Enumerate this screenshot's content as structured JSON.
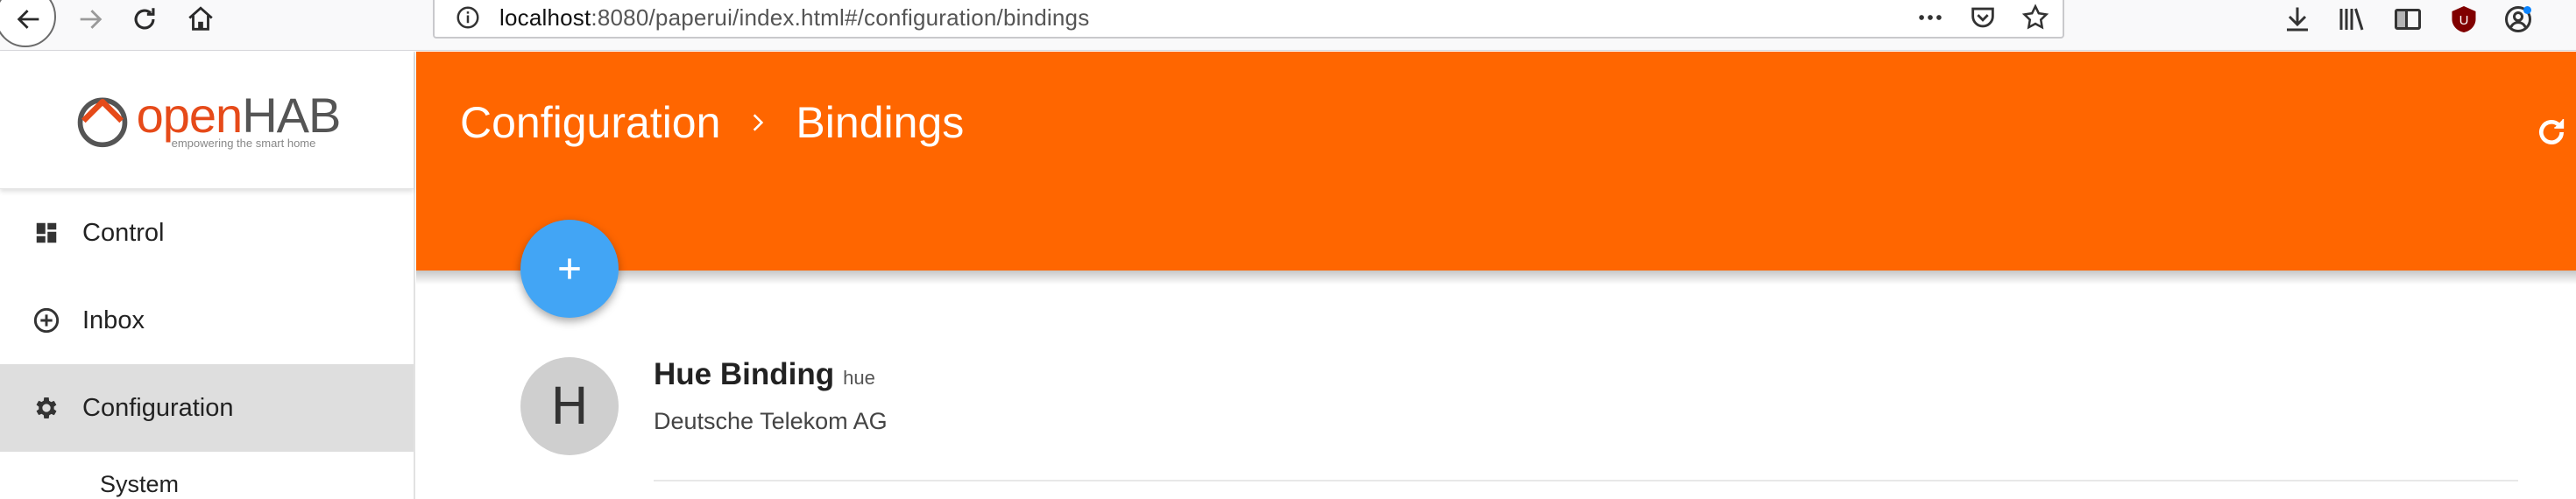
{
  "browser": {
    "url_host": "localhost",
    "url_rest": ":8080/paperui/index.html#/configuration/bindings",
    "icons": [
      "back-arrow-icon",
      "forward-arrow-icon",
      "reload-icon",
      "home-icon",
      "info-icon",
      "more-dots-icon",
      "pocket-icon",
      "bookmark-star-icon",
      "download-icon",
      "library-icon",
      "reader-sidebar-icon",
      "ublock-icon",
      "account-icon"
    ],
    "extension_badge": "U"
  },
  "sidebar": {
    "logo": {
      "word_open": "open",
      "word_hab": "HAB",
      "tagline": "empowering the smart home"
    },
    "items": [
      {
        "label": "Control",
        "icon": "dashboard-icon",
        "active": false
      },
      {
        "label": "Inbox",
        "icon": "add-circle-icon",
        "active": false
      },
      {
        "label": "Configuration",
        "icon": "gear-icon",
        "active": true
      }
    ],
    "sub_items": [
      {
        "label": "System"
      }
    ]
  },
  "header": {
    "breadcrumb": [
      "Configuration",
      "Bindings"
    ],
    "accent": "#ff6600"
  },
  "fab": {
    "label": "+",
    "color": "#42a5f5"
  },
  "bindings": [
    {
      "avatar_letter": "H",
      "name": "Hue Binding",
      "id": "hue",
      "author": "Deutsche Telekom AG"
    }
  ]
}
